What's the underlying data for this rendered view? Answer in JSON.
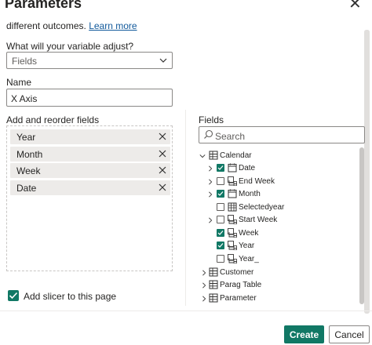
{
  "dialog": {
    "title": "Parameters",
    "intro_text": "different outcomes.",
    "learn_more": "Learn more"
  },
  "left": {
    "adjust_label": "What will your variable adjust?",
    "adjust_value": "Fields",
    "name_label": "Name",
    "name_value": "X Axis",
    "reorder_label": "Add and reorder fields",
    "fields": [
      "Year",
      "Month",
      "Week",
      "Date"
    ],
    "slicer_label": "Add slicer to this page",
    "slicer_checked": true
  },
  "right": {
    "fields_label": "Fields",
    "search_placeholder": "Search",
    "tree": {
      "calendar": {
        "label": "Calendar",
        "expanded": true,
        "icon": "table-icon"
      },
      "calendar_children": [
        {
          "label": "Date",
          "checked": true,
          "expandable": true,
          "icon": "calendar-icon"
        },
        {
          "label": "End Week",
          "checked": false,
          "expandable": true,
          "icon": "hierarchy-icon"
        },
        {
          "label": "Month",
          "checked": true,
          "expandable": true,
          "icon": "calendar-icon"
        },
        {
          "label": "Selectedyear",
          "checked": false,
          "expandable": false,
          "icon": "calc-table-icon"
        },
        {
          "label": "Start Week",
          "checked": false,
          "expandable": true,
          "icon": "hierarchy-icon"
        },
        {
          "label": "Week",
          "checked": true,
          "expandable": false,
          "icon": "hierarchy-icon"
        },
        {
          "label": "Year",
          "checked": true,
          "expandable": false,
          "icon": "hierarchy-icon"
        },
        {
          "label": "Year_",
          "checked": false,
          "expandable": false,
          "icon": "hierarchy-icon"
        }
      ],
      "tables": [
        {
          "label": "Customer",
          "icon": "table-icon"
        },
        {
          "label": "Parag Table",
          "icon": "table-icon"
        },
        {
          "label": "Parameter",
          "icon": "table-icon"
        }
      ]
    }
  },
  "footer": {
    "create_label": "Create",
    "cancel_label": "Cancel"
  },
  "colors": {
    "accent": "#117865",
    "link": "#11599b"
  }
}
